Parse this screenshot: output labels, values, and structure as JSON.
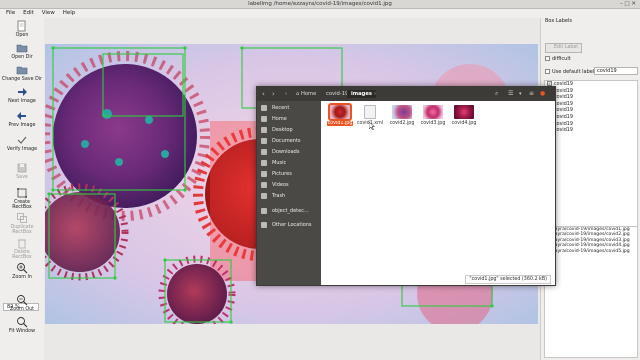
{
  "window": {
    "title": "labelImg /home/ezzayra/covid-19/images/covid1.jpg",
    "controls": "– □ ✕"
  },
  "menu": [
    "File",
    "Edit",
    "View",
    "Help"
  ],
  "toolbar": {
    "open": "Open",
    "open_dir": "Open Dir",
    "change_save_dir": "Change Save Dir",
    "next_image": "Next Image",
    "prev_image": "Prev Image",
    "verify_image": "Verify Image",
    "save": "Save",
    "create_rectbox_1": "Create",
    "create_rectbox_2": "RectBox",
    "duplicate_rectbox_1": "Duplicate",
    "duplicate_rectbox_2": "RectBox",
    "delete_rectbox_1": "Delete",
    "delete_rectbox_2": "RectBox",
    "zoom_in": "Zoom In",
    "zoom_value": "82 %",
    "zoom_out": "Zoom Out",
    "fit_window": "Fit Window"
  },
  "right_panel": {
    "box_labels_title": "Box Labels",
    "edit_label": "Edit Label",
    "difficult": "difficult",
    "use_default_label": "Use default label",
    "default_label_value": "covid19",
    "labels": [
      "covid19",
      "covid19",
      "covid19",
      "covid19",
      "covid19",
      "covid19",
      "covid19",
      "covid19"
    ],
    "files": [
      "ezzayra/covid-19/images/covid1.jpg",
      "ezzayra/covid-19/images/covid2.jpg",
      "ezzayra/covid-19/images/covid3.jpg",
      "ezzayra/covid-19/images/covid4.jpg",
      "ezzayra/covid-19/images/covid5.jpg"
    ]
  },
  "file_manager": {
    "breadcrumbs": [
      "Home",
      "covid-19",
      "images"
    ],
    "places": [
      "Recent",
      "Home",
      "Desktop",
      "Documents",
      "Downloads",
      "Music",
      "Pictures",
      "Videos",
      "Trash",
      "object_detec...",
      "Other Locations"
    ],
    "files": [
      "covid1.jpg",
      "covid1.xml",
      "covid2.jpg",
      "covid3.jpg",
      "covid4.jpg"
    ],
    "status": "\"covid1.jpg\" selected (360.2 kB)"
  },
  "colors": {
    "accent": "#e95420",
    "box_outline": "#2ecc40",
    "fm_header": "#3c3b37",
    "fm_sidebar": "#4a4945"
  }
}
